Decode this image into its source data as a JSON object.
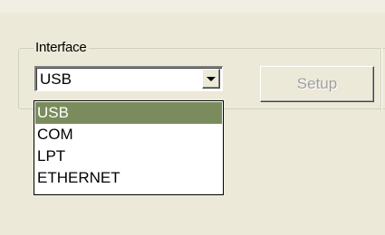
{
  "interface_group": {
    "legend": "Interface",
    "selected_value": "USB",
    "setup_label": "Setup",
    "options": [
      "USB",
      "COM",
      "LPT",
      "ETHERNET"
    ],
    "highlighted_index": 0
  },
  "colors": {
    "dialog_background": "#ece9d8",
    "selection_highlight": "#7a8c5d",
    "disabled_text": "#a0a0a0"
  }
}
